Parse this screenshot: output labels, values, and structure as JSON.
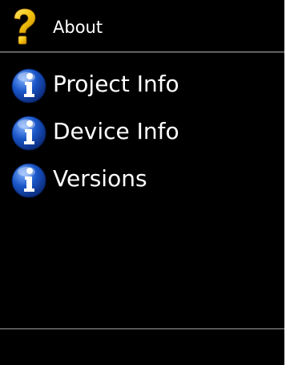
{
  "header": {
    "title": "About",
    "icon": "question-mark-icon"
  },
  "menu": {
    "items": [
      {
        "label": "Project Info",
        "icon": "info-icon"
      },
      {
        "label": "Device Info",
        "icon": "info-icon"
      },
      {
        "label": "Versions",
        "icon": "info-icon"
      }
    ]
  },
  "colors": {
    "background": "#000000",
    "text": "#ffffff",
    "question_yellow": "#f2c40f",
    "info_blue": "#1a56c8"
  }
}
